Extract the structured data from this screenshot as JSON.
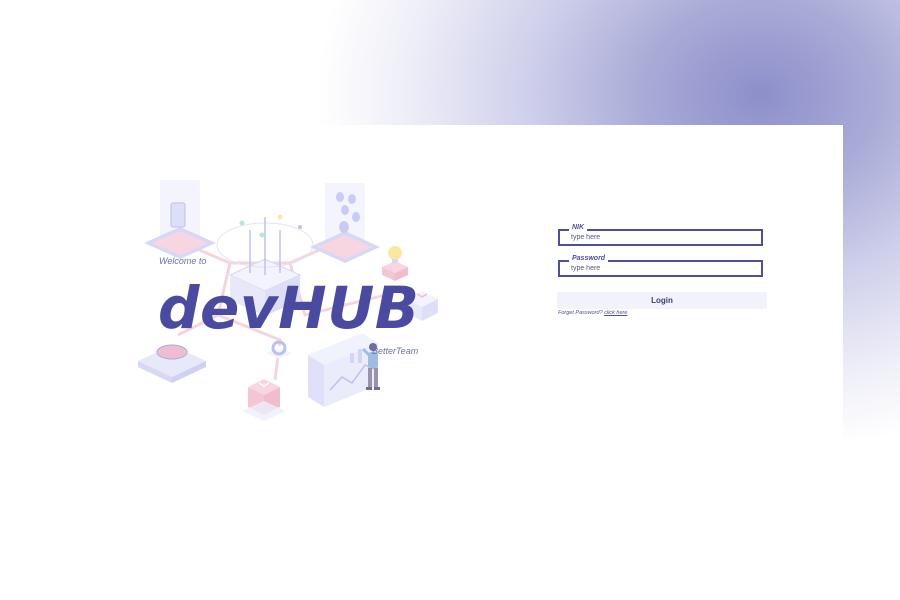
{
  "branding": {
    "welcome": "Welcome to",
    "title": "devHUB",
    "tagline": "BetterTeam"
  },
  "login_form": {
    "nik_field": {
      "label": "NIK",
      "placeholder": "type here",
      "value": ""
    },
    "password_field": {
      "label": "Password",
      "placeholder": "type here",
      "value": ""
    },
    "login_button": "Login",
    "forgot_prompt": "Forget Password?",
    "forgot_link": "click here"
  },
  "illustration": {
    "description_icons": [
      "server-stack-icon",
      "lightbulb-icon",
      "analytics-screen-icon",
      "person-figure-icon",
      "gear-icon",
      "data-cube-icon"
    ]
  },
  "colors": {
    "brand": "#4a4aa0",
    "accent": "#4e4e9c",
    "button_bg": "#f2f2fb",
    "background_glow": "#8d8fcb"
  }
}
